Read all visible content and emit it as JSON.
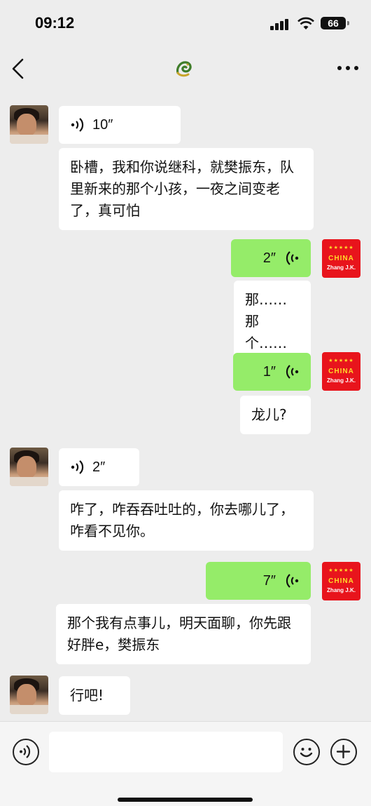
{
  "status_bar": {
    "time": "09:12",
    "battery": "66"
  },
  "nav": {
    "back_icon": "chevron-left-icon",
    "title_icon": "dragon-icon",
    "more_icon": "ellipsis-icon"
  },
  "right_avatar": {
    "stars": "★★★★★",
    "line1": "CHINA",
    "line2": "Zhang J.K."
  },
  "messages": [
    {
      "side": "left",
      "type": "voice",
      "duration": "10″"
    },
    {
      "side": "left",
      "type": "text",
      "text": "卧槽，我和你说继科，就樊振东，队里新来的那个小孩，一夜之间变老了，真可怕"
    },
    {
      "side": "right",
      "type": "voice",
      "duration": "2″"
    },
    {
      "side": "right",
      "type": "text",
      "text": "那……\n那个……"
    },
    {
      "side": "right",
      "type": "voice",
      "duration": "1″"
    },
    {
      "side": "right",
      "type": "text",
      "text": "龙儿?"
    },
    {
      "side": "left",
      "type": "voice",
      "duration": "2″"
    },
    {
      "side": "left",
      "type": "text",
      "text": "咋了，咋吞吞吐吐的，你去哪儿了，咋看不见你。"
    },
    {
      "side": "right",
      "type": "voice",
      "duration": "7″"
    },
    {
      "side": "right",
      "type": "text",
      "text": "那个我有点事儿，明天面聊，你先跟好胖e，樊振东"
    },
    {
      "side": "left",
      "type": "text",
      "text": "行吧!"
    }
  ],
  "input_bar": {
    "placeholder": ""
  },
  "colors": {
    "bubble_green": "#95ec69",
    "bubble_white": "#ffffff",
    "background": "#ededed"
  }
}
